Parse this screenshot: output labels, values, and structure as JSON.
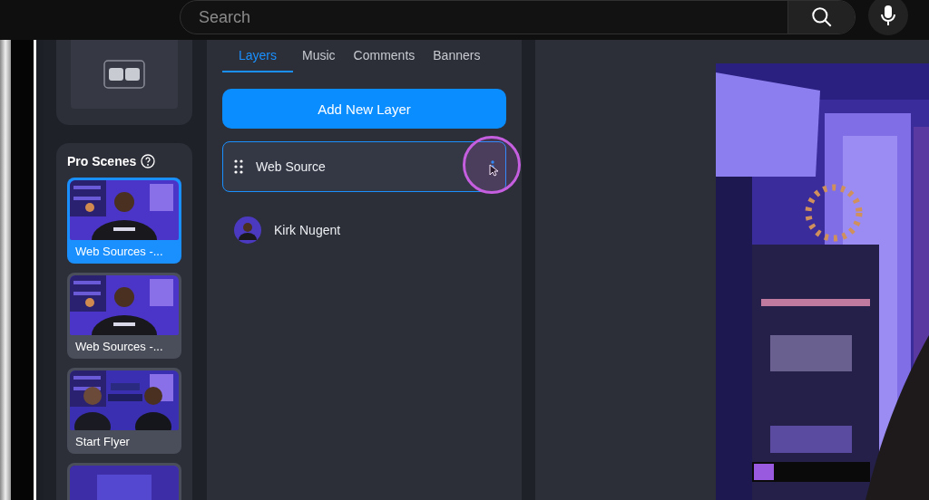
{
  "search": {
    "placeholder": "Search"
  },
  "scenes_panel": {
    "title": "Pro Scenes",
    "scenes": [
      {
        "label": "Web Sources -...",
        "selected": true
      },
      {
        "label": "Web Sources -...",
        "selected": false
      },
      {
        "label": "Start Flyer",
        "selected": false
      },
      {
        "selected": false
      }
    ]
  },
  "tabs": [
    {
      "label": "Layers",
      "selected": true
    },
    {
      "label": "Music",
      "selected": false
    },
    {
      "label": "Comments",
      "selected": false
    },
    {
      "label": "Banners",
      "selected": false
    }
  ],
  "add_layer_button": "Add New Layer",
  "layers": [
    {
      "name": "Web Source",
      "kind": "source",
      "selected": true
    },
    {
      "name": "Kirk Nugent",
      "kind": "camera",
      "selected": false
    }
  ]
}
